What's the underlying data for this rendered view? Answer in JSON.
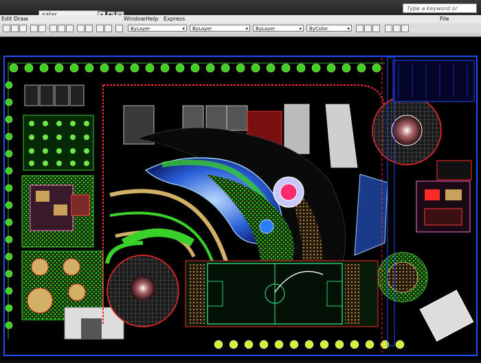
{
  "titlebar": {
    "search_value": "salar",
    "keyword_placeholder": "Type a keyword or phrase"
  },
  "menu": {
    "items": [
      "Edit",
      "Draw",
      "Window",
      "Help",
      "Express"
    ],
    "right_item": "File"
  },
  "properties": {
    "layer": "ByLayer",
    "linetype": "ByLayer",
    "lineweight": "ByLayer",
    "color": "ByColor"
  },
  "drawing": {
    "accent": "#ff2a2a",
    "tree_color": "#39d12a",
    "boundary_color": "#1e4dff",
    "pitch_color": "#2dd07a"
  }
}
